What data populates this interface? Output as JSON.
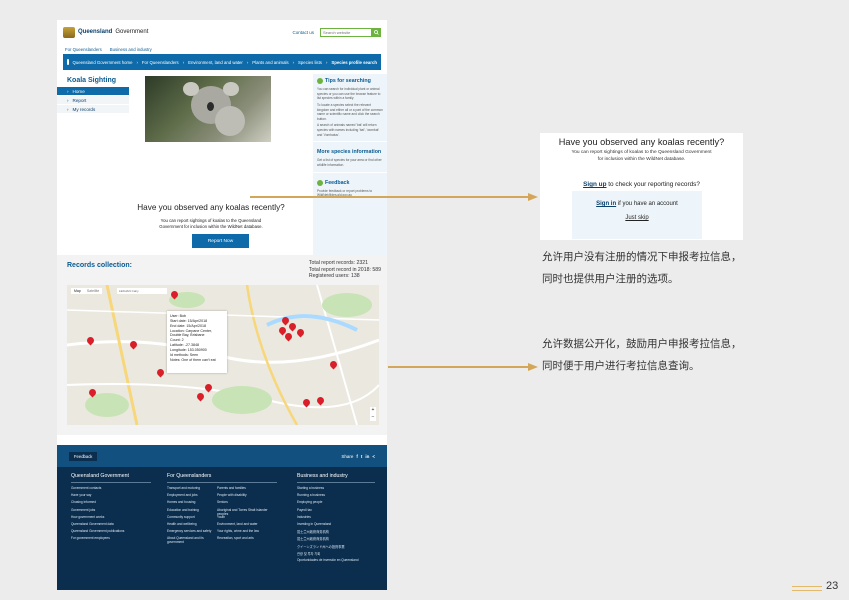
{
  "header": {
    "brand": "Queensland",
    "brand_suffix": "Government",
    "contact": "Contact us",
    "search_placeholder": "Search website"
  },
  "subnav": [
    "For Queenslanders",
    "Business and industry"
  ],
  "breadcrumb": [
    "Queensland Government home",
    "For Queenslanders",
    "Environment, land and water",
    "Plants and animals",
    "Species lists",
    "Species profile search"
  ],
  "sidebar": {
    "title": "Koala Sighting",
    "items": [
      "Home",
      "Report",
      "My records"
    ]
  },
  "main": {
    "title": "Have you observed any koalas recently?",
    "desc": "You can report sightings of koalas to the Queensland Government for inclusion within the WildNet database.",
    "button": "Report Now"
  },
  "tips": {
    "title": "Tips for searching",
    "p1": "You can search for individual plant or animal species or you can use the browse feature to list species within a family.",
    "p2": "To locate a species select the relevant kingdom and either all or a part of the common name or scientific name and click the search button.",
    "p3": "A search of animals named 'bat' will return species with names including 'bat', 'wombat' and 'Vombatus'.",
    "more_title": "More species information",
    "more_text": "Get a list of species for your area or find other wildlife information.",
    "feedback_title": "Feedback",
    "feedback_text": "Provide feedback or report problems to WildNet@des.qld.gov.au"
  },
  "records": {
    "title": "Records collection:",
    "total": "Total report records: 2321",
    "year": "Total report record in 2018: 589",
    "users": "Registered users: 138"
  },
  "map": {
    "tabs": [
      "Map",
      "Satellite"
    ],
    "search": "LEIGIAN Cairy",
    "popup": [
      "User: Bob",
      "Start date: 15/Apr/2018",
      "End date: 15/Apr/2018",
      "Location: Carpane Center, Double Bay, Brisbane",
      "Count: 2",
      "Latitude: -27.3848",
      "Longitude: 153.050900",
      "Id methods: Seen",
      "Notes: One of them can't eat"
    ]
  },
  "footer": {
    "feedback": "Feedback",
    "share": "Share",
    "cols": [
      {
        "title": "Queensland Government",
        "items": [
          "Government contacts",
          "Have your say",
          "Chasing informed",
          "Government jobs",
          "How government works",
          "Queensland Government data",
          "Queensland Government publications",
          "For government employees"
        ]
      },
      {
        "title": "For Queenslanders",
        "items": [
          "Transport and motoring",
          "Employment and jobs",
          "Homes and housing",
          "Education and training",
          "Community support",
          "Health and wellbeing",
          "Emergency services and safety",
          "About Queensland and its government"
        ]
      },
      {
        "title": "",
        "items": [
          "Parents and families",
          "People with disability",
          "Seniors",
          "Aboriginal and Torres Strait Islander peoples",
          "Youth",
          "Environment, land and water",
          "Your rights, crime and the law",
          "Recreation, sport and arts"
        ]
      },
      {
        "title": "Business and industry",
        "items": [
          "Starting a business",
          "Running a business",
          "Employing people",
          "Payroll tax",
          "Industries",
          "Investing in Queensland",
          "昆士兰州政府商务机构",
          "昆士兰州政府商务机构",
          "クイーンズランド州への投資事業",
          "관광 및 투자 기회",
          "Oportunidades de inversión en Queensland"
        ]
      }
    ]
  },
  "right_card": {
    "title": "Have you observed any koalas recently?",
    "desc": "You can report sightings of koalas to the Queensland Government for inclusion within the WildNet database.",
    "l1_link": "Sign up",
    "l1_rest": " to check your reporting records?",
    "l2_link": "Sign in",
    "l2_rest": " if you have an account",
    "l3": "Just skip"
  },
  "annotations": {
    "a1": "允许用户没有注册的情况下申报考拉信息，同时也提供用户注册的选项。",
    "a2": "允许数据公开化，鼓励用户申报考拉信息，同时便于用户进行考拉信息查询。"
  },
  "page_number": "23",
  "colors": {
    "primary": "#0e6aa8",
    "accent": "#6cb33f",
    "pin": "#d9202a",
    "footer": "#0b2e4f",
    "arrow": "#d4a65a"
  }
}
